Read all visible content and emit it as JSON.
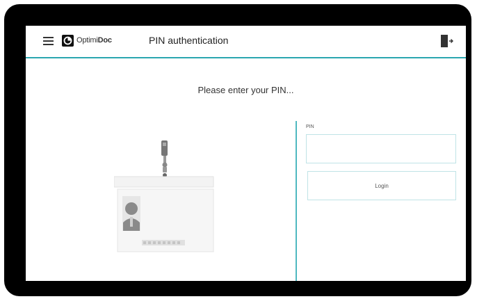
{
  "header": {
    "menu_icon": "hamburger-menu-icon",
    "logo": {
      "light": "Optimi",
      "bold": "Doc",
      "icon": "optimidoc-logo-icon"
    },
    "title": "PIN authentication",
    "logout_icon": "logout-door-icon"
  },
  "main": {
    "prompt": "Please enter your PIN...",
    "illustration_icon": "id-badge-icon"
  },
  "form": {
    "pin_label": "PIN",
    "pin_value": "",
    "login_label": "Login"
  },
  "colors": {
    "accent": "#2aa7b0",
    "bezel": "#000000",
    "input_border": "#bfe3e6"
  }
}
